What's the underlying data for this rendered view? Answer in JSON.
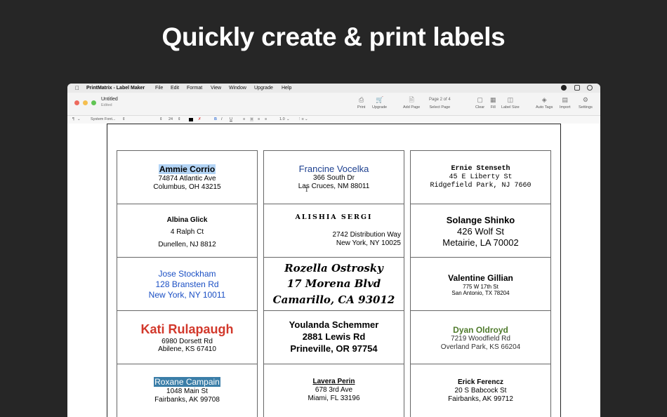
{
  "headline": "Quickly create & print labels",
  "menubar": {
    "app_name": "PrintMatrix - Label Maker",
    "items": [
      "File",
      "Edit",
      "Format",
      "View",
      "Window",
      "Upgrade",
      "Help"
    ]
  },
  "document": {
    "title": "Untitled",
    "subtitle": "Edited"
  },
  "toolbar": {
    "print": "Print",
    "upgrade": "Upgrade",
    "add_page": "Add Page",
    "page_indicator": "Page 2 of 4",
    "select_page": "Select Page",
    "clear": "Clear",
    "fill": "Fill",
    "label_size": "Label Size",
    "auto_tags": "Auto Tags",
    "import": "Import",
    "settings": "Settings"
  },
  "formatbar": {
    "paragraph": "¶",
    "font": "System Font...",
    "size": "24",
    "line_spacing": "1.0"
  },
  "labels": [
    [
      {
        "lines": [
          "Ammie Corrio",
          "74874 Atlantic Ave",
          "Columbus, OH 43215"
        ]
      },
      {
        "lines": [
          "Albina Glick",
          "4 Ralph Ct",
          "Dunellen, NJ 8812"
        ]
      },
      {
        "lines": [
          "Jose Stockham",
          "128 Bransten Rd",
          "New York, NY 10011"
        ]
      },
      {
        "lines": [
          "Kati Rulapaugh",
          "6980 Dorsett Rd",
          "Abilene, KS 67410"
        ]
      },
      {
        "lines": [
          "Roxane Campain",
          "1048 Main St",
          "Fairbanks, AK 99708"
        ]
      }
    ],
    [
      {
        "lines": [
          "Francine Vocelka",
          "366 South Dr",
          "Las Cruces, NM 88011"
        ]
      },
      {
        "lines": [
          "Alishia Sergi",
          "2742 Distribution Way",
          "New York, NY 10025"
        ]
      },
      {
        "lines": [
          "Rozella Ostrosky",
          "17 Morena Blvd",
          "Camarillo, CA 93012"
        ]
      },
      {
        "lines": [
          "Youlanda Schemmer",
          "2881 Lewis Rd",
          "Prineville, OR 97754"
        ]
      },
      {
        "lines": [
          "Lavera Perin",
          "678 3rd Ave",
          "Miami, FL 33196"
        ]
      }
    ],
    [
      {
        "lines": [
          "Ernie Stenseth",
          "45 E Liberty St",
          "Ridgefield Park, NJ 7660"
        ]
      },
      {
        "lines": [
          "Solange Shinko",
          "426 Wolf St",
          "Metairie, LA 70002"
        ]
      },
      {
        "lines": [
          "Valentine Gillian",
          "775 W 17th St",
          "San Antonio, TX 78204"
        ]
      },
      {
        "lines": [
          "Dyan Oldroyd",
          "7219 Woodfield Rd",
          "Overland Park, KS 66204"
        ]
      },
      {
        "lines": [
          "Erick Ferencz",
          "20 S Babcock St",
          "Fairbanks, AK 99712"
        ]
      }
    ]
  ],
  "colors": {
    "background": "#262626",
    "highlight_light": "#b3d4f5",
    "highlight_teal": "#3b7ea8",
    "blue_text": "#1a4fc4",
    "red_text": "#d2382b",
    "green_text": "#4f7a2c",
    "navy_text": "#1c3f8f"
  }
}
